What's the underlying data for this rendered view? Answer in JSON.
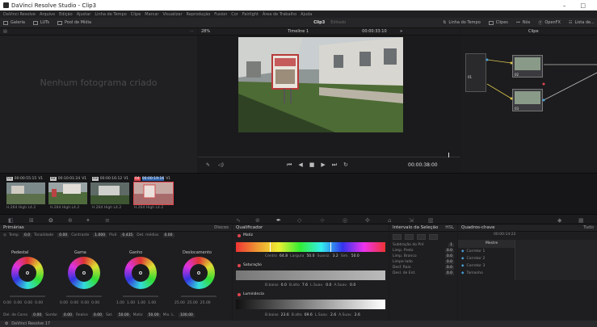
{
  "app": {
    "title": "DaVinci Resolve Studio - Clip3",
    "window_controls": [
      "–",
      "□"
    ]
  },
  "menu": [
    "DaVinci Resolve",
    "Arquivo",
    "Edição",
    "Ajustar",
    "Linha de Tempo",
    "Clipe",
    "Marcar",
    "Visualizar",
    "Reprodução",
    "Fusion",
    "Cor",
    "Fairlight",
    "Área de Trabalho",
    "Ajuda"
  ],
  "toolbar": {
    "gallery": "Galeria",
    "luts": "LUTs",
    "media_pool": "Pool de Mídia",
    "project": "Clip3",
    "project_state": "Editado",
    "timeline_lut": "Linha do Tempo",
    "clips_label": "Clipes",
    "node_label": "Nós",
    "overlay_label": "OpenFX",
    "library_label": "Lista de..."
  },
  "subbar": {
    "zoom": "28%",
    "timeline_name": "Timeline 1",
    "timecode_in": "00:00:33:10",
    "clip_mode": "Clipe"
  },
  "gallery": {
    "placeholder": "Nenhum fotograma criado"
  },
  "viewer": {
    "timecode": "00:00:38:00"
  },
  "nodes": {
    "node1": "01",
    "node2": "02",
    "node3": "03"
  },
  "clips": [
    {
      "num": "01",
      "tc": "00:00:55:15",
      "track": "V1",
      "codec": "H.264 High L4.2",
      "selected": false
    },
    {
      "num": "02",
      "tc": "00:10:01:24",
      "track": "V1",
      "codec": "H.264 High L4.2",
      "selected": false
    },
    {
      "num": "03",
      "tc": "00:00:16:12",
      "track": "V1",
      "codec": "H.264 High L4.2",
      "selected": false
    },
    {
      "num": "04",
      "tc": "00:00:19:16",
      "track": "V1",
      "codec": "H.264 High L4.2",
      "selected": true
    }
  ],
  "primaries": {
    "title": "Primárias",
    "mode": "Discos",
    "temp_label": "Temp",
    "temp": "0.0",
    "tint_label": "Tonalidade",
    "tint": "0.00",
    "contrast_label": "Contraste",
    "contrast": "1.000",
    "pivot_label": "Pivô",
    "pivot": "0.435",
    "detail_label": "Det. médios",
    "detail": "0.00",
    "wheels": [
      {
        "label": "Pedestal",
        "values": [
          "0.00",
          "0.00",
          "0.00",
          "0.00"
        ]
      },
      {
        "label": "Gama",
        "values": [
          "0.00",
          "0.00",
          "0.00",
          "0.00"
        ]
      },
      {
        "label": "Ganho",
        "values": [
          "1.00",
          "1.00",
          "1.00",
          "1.00"
        ]
      },
      {
        "label": "Deslocamento",
        "values": [
          "25.00",
          "25.00",
          "25.00"
        ]
      }
    ],
    "bottom": [
      {
        "label": "Del. de Cores",
        "value": "0.00"
      },
      {
        "label": "Sombr.",
        "value": "0.00"
      },
      {
        "label": "Realce",
        "value": "0.00"
      },
      {
        "label": "Sat.",
        "value": "50.00"
      },
      {
        "label": "Matiz",
        "value": "50.00"
      },
      {
        "label": "Mix. L.",
        "value": "100.00"
      }
    ]
  },
  "qualifier": {
    "title": "Qualificador",
    "hue_label": "Matiz",
    "hue_center_label": "Centro",
    "hue_center": "64.8",
    "hue_width_label": "Largura",
    "hue_width": "50.0",
    "hue_soft_label": "Suaviz.",
    "hue_soft": "3.2",
    "hue_sym_label": "Sim.",
    "hue_sym": "50.0",
    "sat_label": "Saturação",
    "sat_low_label": "B.baixo",
    "sat_low": "0.0",
    "sat_high_label": "B.alto",
    "sat_high": "7.6",
    "sat_lsoft_label": "L.Suav.",
    "sat_lsoft": "0.0",
    "sat_hsoft_label": "A.Suav.",
    "sat_hsoft": "0.0",
    "lum_label": "Luminância",
    "lum_low_label": "B.baixo",
    "lum_low": "23.6",
    "lum_high_label": "B.alto",
    "lum_high": "69.6",
    "lum_lsoft_label": "L.Suav.",
    "lum_lsoft": "2.6",
    "lum_hsoft_label": "A.Suav.",
    "lum_hsoft": "2.6",
    "mode": "HSL"
  },
  "keyer": {
    "title": "Intervalo da Seleção",
    "rows": [
      {
        "label": "Subtração do Pré",
        "value": "1"
      },
      {
        "label": "Limp. Preto",
        "value": "0.0"
      },
      {
        "label": "Limp. Branco",
        "value": "0.0"
      },
      {
        "label": "Limpe lado",
        "value": "0.0"
      },
      {
        "label": "Desf. Raio",
        "value": "0.0"
      },
      {
        "label": "Desl. de Ent.",
        "value": "0.0"
      }
    ]
  },
  "keyframes": {
    "title": "Quadros-chave",
    "timecode": "00:00:14:22",
    "filter": "Tudo",
    "rows": [
      "Mestre",
      "Corretor 1",
      "Corretor 2",
      "Corretor 3",
      "Tamanho"
    ]
  },
  "status": {
    "label": "DaVinci Resolve 17"
  },
  "colors": {
    "accent": "#e0454e",
    "background": "#1e1e20",
    "panel": "#232325"
  }
}
